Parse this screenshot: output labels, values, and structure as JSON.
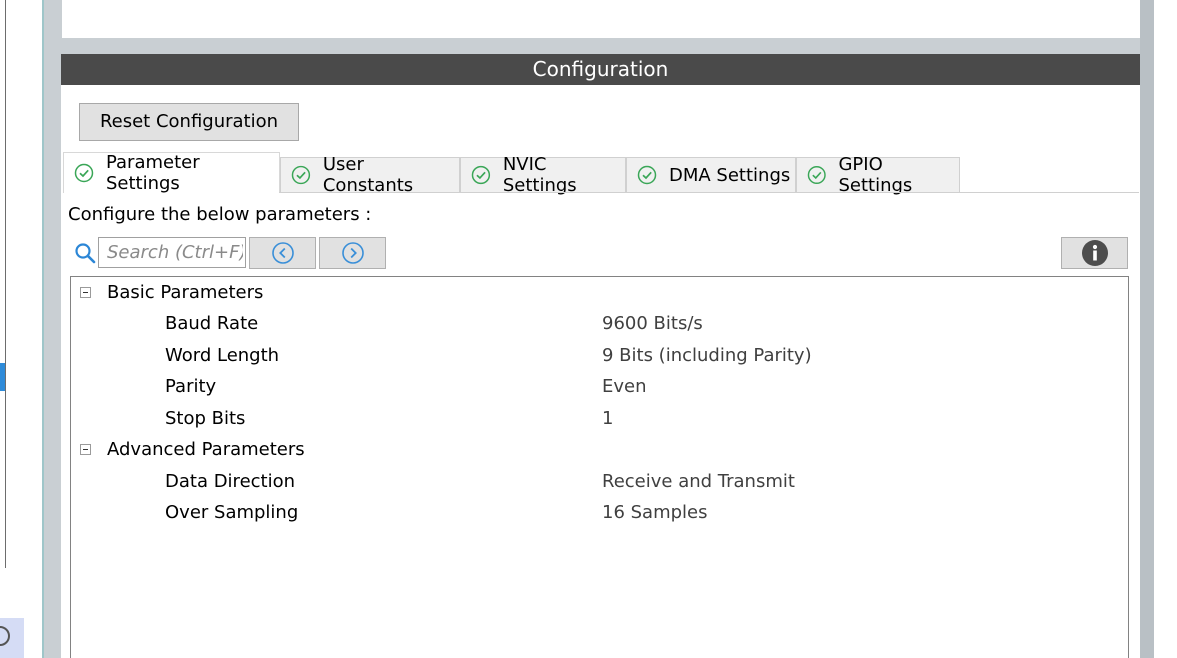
{
  "header": {
    "title": "Configuration"
  },
  "toolbar": {
    "reset_label": "Reset Configuration"
  },
  "tabs": [
    {
      "label": "Parameter Settings",
      "active": true
    },
    {
      "label": "User Constants",
      "active": false
    },
    {
      "label": "NVIC Settings",
      "active": false
    },
    {
      "label": "DMA Settings",
      "active": false
    },
    {
      "label": "GPIO Settings",
      "active": false
    }
  ],
  "main": {
    "configure_label": "Configure the below parameters :",
    "search": {
      "placeholder": "Search (Ctrl+F)"
    }
  },
  "tree": {
    "groups": [
      {
        "label": "Basic Parameters",
        "params": [
          {
            "name": "Baud Rate",
            "value": "9600 Bits/s"
          },
          {
            "name": "Word Length",
            "value": "9 Bits (including Parity)"
          },
          {
            "name": "Parity",
            "value": "Even"
          },
          {
            "name": "Stop Bits",
            "value": "1"
          }
        ]
      },
      {
        "label": "Advanced Parameters",
        "params": [
          {
            "name": "Data Direction",
            "value": "Receive and Transmit"
          },
          {
            "name": "Over Sampling",
            "value": "16 Samples"
          }
        ]
      }
    ]
  },
  "colors": {
    "header_bg": "#4a4a4a",
    "check_green": "#3aa657",
    "search_blue": "#2b86d6",
    "nav_arrow_blue": "#3a8fd8"
  },
  "icons": {
    "tab_status": "check-circle-icon",
    "search": "search-icon",
    "prev": "chevron-left-circle-icon",
    "next": "chevron-right-circle-icon",
    "info": "info-icon",
    "collapse": "collapse-minus-icon"
  }
}
